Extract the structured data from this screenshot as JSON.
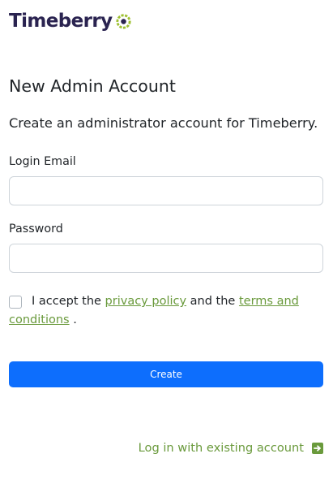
{
  "brand": {
    "name": "Timeberry",
    "logo_icon": "timeberry-ring-logo",
    "name_color": "#2a2350",
    "ring_color": "#9ec031"
  },
  "page": {
    "title": "New Admin Account",
    "subtitle": "Create an administrator account for Timeberry."
  },
  "form": {
    "email": {
      "label": "Login Email",
      "value": "",
      "placeholder": ""
    },
    "password": {
      "label": "Password",
      "value": "",
      "placeholder": ""
    },
    "consent": {
      "checked": false,
      "prefix": "I accept the",
      "privacy_link": "privacy policy",
      "middle": "and the",
      "terms_link": "terms and conditions",
      "suffix": "."
    },
    "submit_label": "Create"
  },
  "footer": {
    "login_link": "Log in with existing account",
    "login_icon": "arrow-right-square-icon"
  },
  "colors": {
    "primary": "#0d6efd",
    "link": "#6a9a3c",
    "text": "#212529",
    "border": "#ced4da"
  }
}
